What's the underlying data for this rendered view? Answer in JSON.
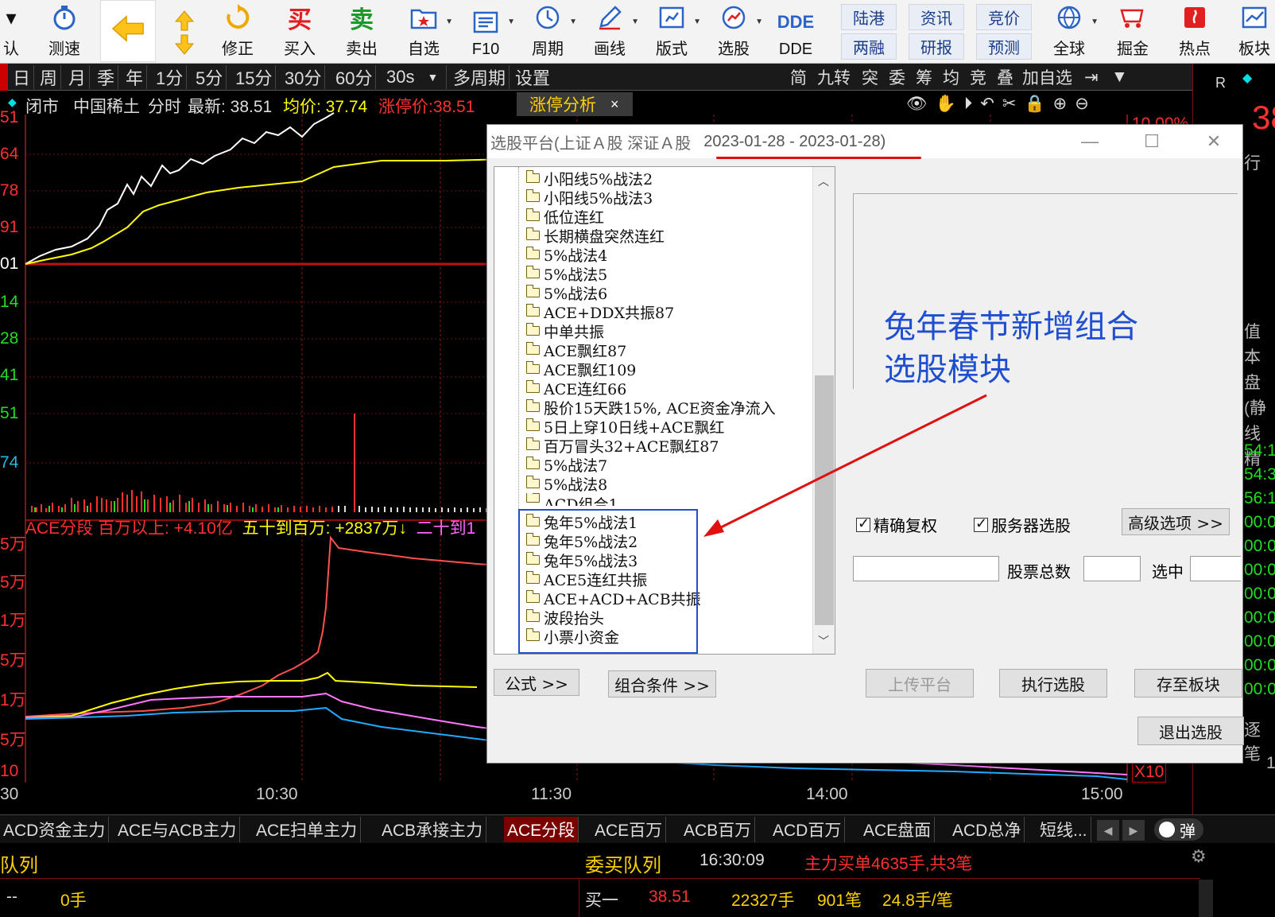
{
  "toolbar": {
    "items": [
      {
        "label": "认"
      },
      {
        "label": "测速"
      },
      {
        "label": "修正"
      },
      {
        "label": "买入"
      },
      {
        "label": "卖出"
      },
      {
        "label": "自选"
      },
      {
        "label": "F10"
      },
      {
        "label": "周期"
      },
      {
        "label": "画线"
      },
      {
        "label": "版式"
      },
      {
        "label": "选股"
      },
      {
        "label": "DDE"
      },
      {
        "label": "全球"
      },
      {
        "label": "掘金"
      },
      {
        "label": "热点"
      },
      {
        "label": "板块"
      }
    ],
    "small": {
      "luganggang": "陆港",
      "liangrong": "两融",
      "zixun": "资讯",
      "yanbao": "研报",
      "jingjia": "竞价",
      "yuce": "预测"
    },
    "icons": {
      "buy_glyph": "买",
      "sell_glyph": "卖",
      "dde_glyph": "DDE"
    }
  },
  "periodbar": {
    "periods": [
      "日",
      "周",
      "月",
      "季",
      "年",
      "1分",
      "5分",
      "15分",
      "30分",
      "60分",
      "30s",
      "多周期",
      "设置"
    ],
    "right": [
      "简",
      "九转",
      "突",
      "委",
      "筹",
      "均",
      "竞",
      "叠",
      "加自选"
    ]
  },
  "stock": {
    "status": "闭市",
    "name": "中国稀土",
    "mode": "分时",
    "latest_label": "最新: 38.51",
    "avg_label": "均价: 37.74",
    "limit_label": "涨停价:38.51",
    "panel_tab": "涨停分析",
    "pct": "10.00%",
    "right_R": "R",
    "right_price": "38"
  },
  "chart": {
    "price_ticks": [
      {
        "label": "51",
        "color": "#ff3030"
      },
      {
        "label": "64",
        "color": "#ff3030"
      },
      {
        "label": "78",
        "color": "#ff3030"
      },
      {
        "label": "91",
        "color": "#ff3030"
      },
      {
        "label": "01",
        "color": "#ffffff"
      },
      {
        "label": "14",
        "color": "#22dd22"
      },
      {
        "label": "28",
        "color": "#22dd22"
      },
      {
        "label": "41",
        "color": "#22dd22"
      },
      {
        "label": "51",
        "color": "#22dd22"
      },
      {
        "label": "74",
        "color": "#22bbdd"
      }
    ],
    "ace_header": {
      "a": "ACE分段 百万以上: +4.10亿",
      "b": "五十到百万: +2837万↓",
      "c": "二十到1"
    },
    "ace_ticks": [
      "5万",
      "5万",
      "1万",
      "5万",
      "1万",
      "5万",
      "10"
    ],
    "x_labels": [
      "30",
      "10:30",
      "11:30",
      "14:00",
      "15:00"
    ],
    "x10": "X10"
  },
  "bottomtabs": [
    "ACD资金主力",
    "ACE与ACB主力",
    "ACE扫单主力",
    "ACB承接主力",
    "ACE分段",
    "ACE百万",
    "ACB百万",
    "ACD百万",
    "ACE盘面",
    "ACD总净",
    "短线..."
  ],
  "bottom_toggle": "弹",
  "queue": {
    "left_title": "队列",
    "right_title": "委买队列",
    "time": "16:30:09",
    "main_order": "主力买单4635手,共3笔",
    "left_row": {
      "a": "--",
      "b": "0手"
    },
    "buy1": {
      "label": "买一",
      "price": "38.51",
      "vol": "22327手",
      "count": "901笔",
      "avg": "24.8手/笔"
    }
  },
  "right_panel": [
    "行",
    "值",
    "本",
    "盘(静",
    "线精",
    "54:1",
    "54:3",
    "56:1",
    "00:0",
    "00:0",
    "00:0",
    "00:0",
    "00:0",
    "00:0",
    "00:0",
    "00:0",
    "逐笔",
    "1"
  ],
  "dialog": {
    "title": "选股平台(上证Ａ股 深证Ａ股",
    "date_range": "2023-01-28 - 2023-01-28)",
    "tree": [
      "小阳线5%战法2",
      "小阳线5%战法3",
      "低位连红",
      "长期横盘突然连红",
      "5%战法4",
      "5%战法5",
      "5%战法6",
      "ACE+DDX共振87",
      "中单共振",
      "ACE飘红87",
      "ACE飘红109",
      "ACE连红66",
      "股价15天跌15%, ACE资金净流入",
      "5日上穿10日线+ACE飘红",
      "百万冒头32+ACE飘红87",
      "5%战法7",
      "5%战法8",
      "ACD组合1",
      "兔年5%战法1",
      "兔年5%战法2",
      "兔年5%战法3",
      "ACE5连红共振",
      "ACE+ACD+ACB共振",
      "波段抬头",
      "小票小资金"
    ],
    "annotation": [
      "兔年春节新增组合",
      "选股模块"
    ],
    "chk_fuquan": "精确复权",
    "chk_server": "服务器选股",
    "advanced": "高级选项 >>",
    "total_label": "股票总数",
    "selected_label": "选中",
    "formula": "公式 >>",
    "combo": "组合条件 >>",
    "upload": "上传平台",
    "execute": "执行选股",
    "save": "存至板块",
    "exit": "退出选股"
  }
}
